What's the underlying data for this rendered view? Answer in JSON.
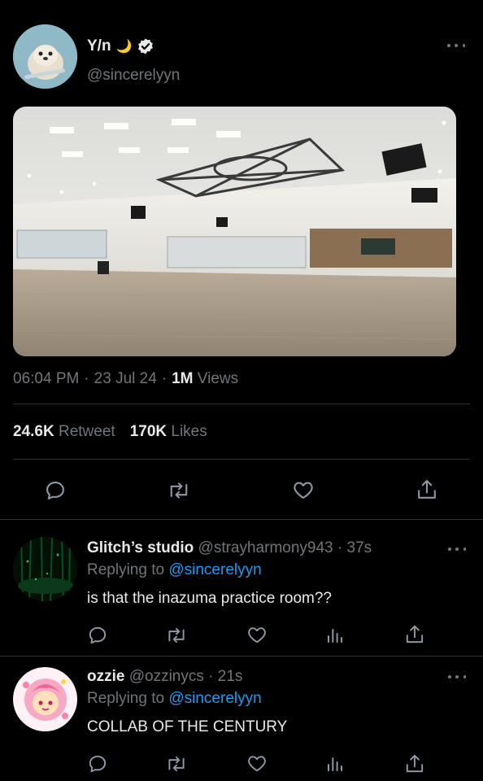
{
  "tweet": {
    "display_name": "Y/n",
    "name_emoji": "🌙",
    "handle": "@sincerelyyn",
    "time": "06:04 PM",
    "sep1": "·",
    "date": "23 Jul 24",
    "sep2": "·",
    "views_count": "1M",
    "views_label": "Views",
    "retweets_count": "24.6K",
    "retweets_label": "Retweet",
    "likes_count": "170K",
    "likes_label": "Likes"
  },
  "replies": [
    {
      "display_name": "Glitch’s studio",
      "handle": "@strayharmony943",
      "time_ago": "· 37s",
      "replying_label": "Replying to",
      "replying_to": "@sincerelyyn",
      "text": "is that the inazuma practice room??"
    },
    {
      "display_name": "ozzie",
      "handle": "@ozzinycs",
      "time_ago": "· 21s",
      "replying_label": "Replying to",
      "replying_to": "@sincerelyyn",
      "text": "COLLAB OF THE CENTURY"
    }
  ],
  "colors": {
    "background": "#000000",
    "text": "#e7e9ea",
    "muted": "#71767b",
    "link": "#1d9bf0",
    "divider": "#2f3336"
  },
  "icons": [
    "verified-badge-icon",
    "more-icon",
    "reply-icon",
    "retweet-icon",
    "like-icon",
    "analytics-icon",
    "share-icon"
  ]
}
